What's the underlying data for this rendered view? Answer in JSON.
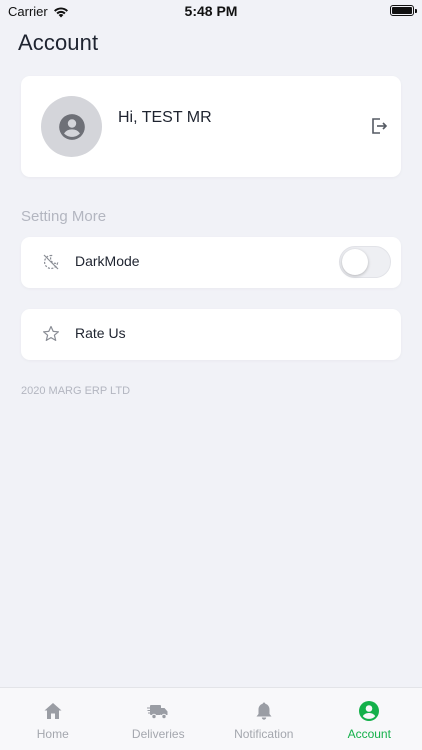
{
  "status_bar": {
    "carrier": "Carrier",
    "time": "5:48 PM"
  },
  "header": {
    "title": "Account"
  },
  "profile": {
    "greeting": "Hi, TEST MR",
    "avatar_icon": "user-circle-icon",
    "logout_icon": "logout-icon"
  },
  "settings": {
    "section_label": "Setting More",
    "items": [
      {
        "label": "DarkMode",
        "icon": "dark-mode-icon",
        "toggle_on": false
      },
      {
        "label": "Rate Us",
        "icon": "star-outline-icon"
      }
    ]
  },
  "footer": {
    "copyright": "2020 MARG ERP LTD"
  },
  "tab_bar": {
    "tabs": [
      {
        "label": "Home",
        "icon": "home-icon",
        "active": false
      },
      {
        "label": "Deliveries",
        "icon": "truck-icon",
        "active": false
      },
      {
        "label": "Notification",
        "icon": "bell-icon",
        "active": false
      },
      {
        "label": "Account",
        "icon": "account-icon",
        "active": true
      }
    ]
  },
  "colors": {
    "background": "#f1f2f7",
    "accent": "#14b04a",
    "inactive": "#a4a7ae",
    "muted_text": "#b3b6c0"
  }
}
